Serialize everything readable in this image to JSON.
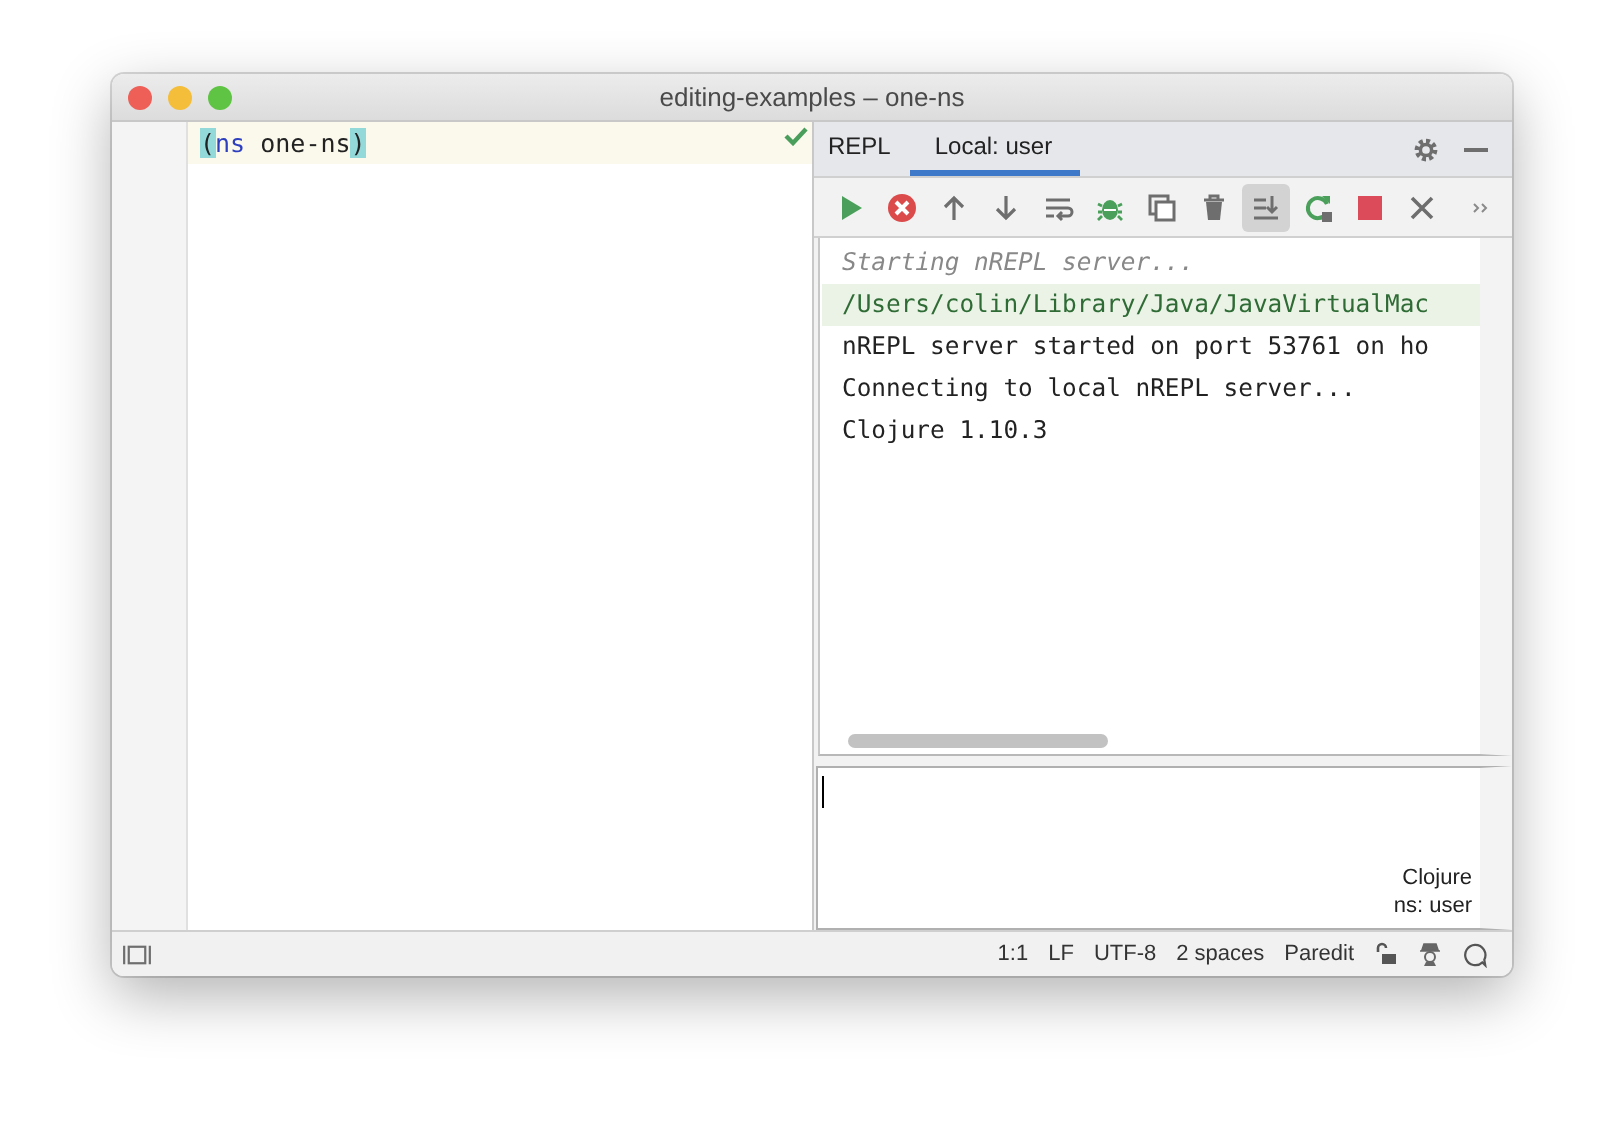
{
  "window": {
    "title": "editing-examples – one-ns"
  },
  "editor": {
    "code_open": "(",
    "code_keyword": "ns",
    "code_name": "one-ns",
    "code_close": ")",
    "status_ok": true
  },
  "repl": {
    "tabs": [
      {
        "label": "REPL",
        "selected": false
      },
      {
        "label": "Local: user",
        "selected": true
      }
    ],
    "toolbar": [
      {
        "kind": "run",
        "on": false
      },
      {
        "kind": "stop-circle",
        "on": false
      },
      {
        "kind": "up",
        "on": false
      },
      {
        "kind": "down",
        "on": false
      },
      {
        "kind": "wrap",
        "on": false
      },
      {
        "kind": "bug",
        "on": false
      },
      {
        "kind": "copy",
        "on": false
      },
      {
        "kind": "trash",
        "on": false
      },
      {
        "kind": "scroll-end",
        "on": true
      },
      {
        "kind": "rerun",
        "on": false
      },
      {
        "kind": "stop",
        "on": false
      },
      {
        "kind": "close",
        "on": false
      },
      {
        "kind": "more",
        "on": false
      }
    ],
    "output": [
      {
        "kind": "info",
        "text": "Starting nREPL server..."
      },
      {
        "kind": "path",
        "text": "/Users/colin/Library/Java/JavaVirtualMac"
      },
      {
        "kind": "plain",
        "text": "nREPL server started on port 53761 on ho"
      },
      {
        "kind": "plain",
        "text": "Connecting to local nREPL server..."
      },
      {
        "kind": "plain",
        "text": "Clojure 1.10.3"
      }
    ],
    "input": {
      "language": "Clojure",
      "namespace": "ns: user"
    }
  },
  "status_bar": {
    "items": [
      "1:1",
      "LF",
      "UTF-8",
      "2 spaces",
      "Paredit"
    ]
  }
}
